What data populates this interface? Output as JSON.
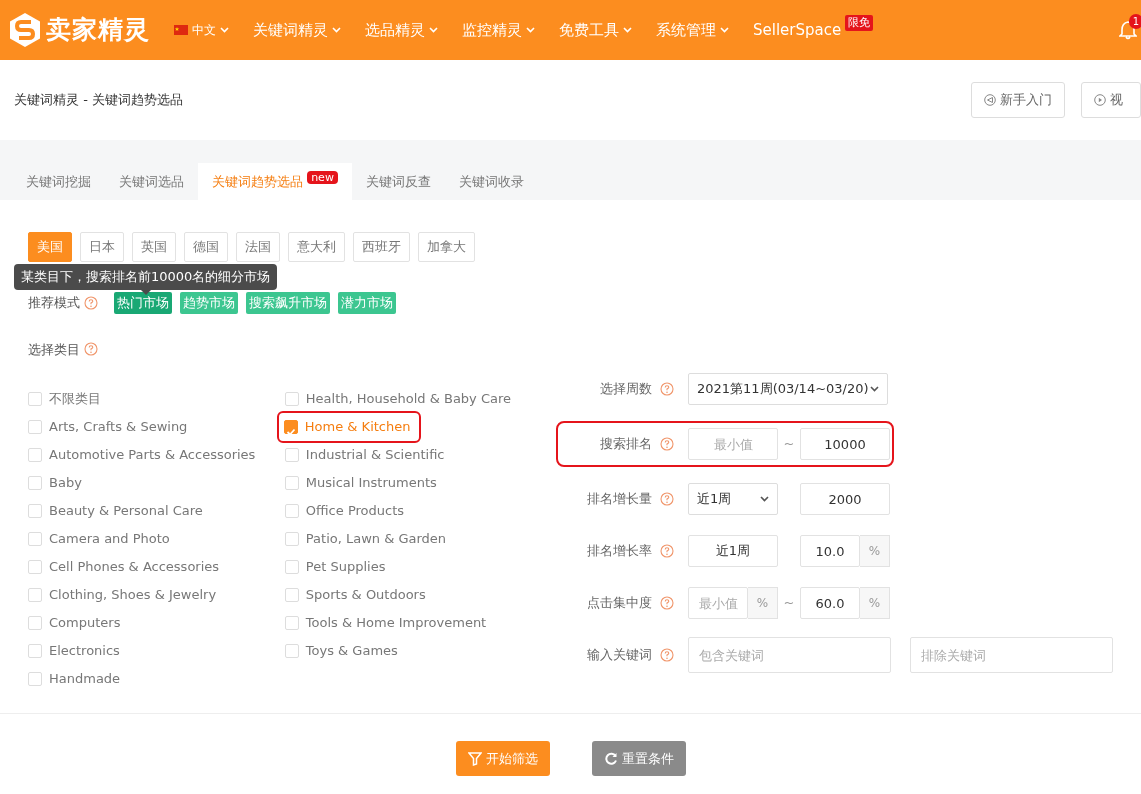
{
  "header": {
    "logo_text": "卖家精灵",
    "language": "中文",
    "nav": [
      {
        "label": "关键词精灵",
        "dropdown": true
      },
      {
        "label": "选品精灵",
        "dropdown": true
      },
      {
        "label": "监控精灵",
        "dropdown": true
      },
      {
        "label": "免费工具",
        "dropdown": true
      },
      {
        "label": "系统管理",
        "dropdown": true
      },
      {
        "label": "SellerSpace",
        "dropdown": false,
        "badge": "限免"
      }
    ],
    "notification_count": "1"
  },
  "breadcrumb": "关键词精灵 - 关键词趋势选品",
  "top_buttons": [
    {
      "label": "新手入门",
      "kind": "guide"
    },
    {
      "label": "视",
      "kind": "video"
    }
  ],
  "tabs": [
    {
      "label": "关键词挖掘",
      "selected": false
    },
    {
      "label": "关键词选品",
      "selected": false
    },
    {
      "label": "关键词趋势选品",
      "selected": true,
      "badge": "new"
    },
    {
      "label": "关键词反查",
      "selected": false
    },
    {
      "label": "关键词收录",
      "selected": false
    }
  ],
  "countries": [
    {
      "label": "美国",
      "selected": true
    },
    {
      "label": "日本",
      "selected": false
    },
    {
      "label": "英国",
      "selected": false
    },
    {
      "label": "德国",
      "selected": false
    },
    {
      "label": "法国",
      "selected": false
    },
    {
      "label": "意大利",
      "selected": false
    },
    {
      "label": "西班牙",
      "selected": false
    },
    {
      "label": "加拿大",
      "selected": false
    }
  ],
  "tooltip": "某类目下，搜索排名前10000名的细分市场",
  "mode": {
    "label": "推荐模式",
    "options": [
      {
        "label": "热门市场",
        "selected": true
      },
      {
        "label": "趋势市场",
        "selected": false
      },
      {
        "label": "搜索飙升市场",
        "selected": false
      },
      {
        "label": "潜力市场",
        "selected": false
      }
    ]
  },
  "category_label": "选择类目",
  "categories": [
    [
      {
        "label": "不限类目",
        "checked": false,
        "highlighted": false
      },
      {
        "label": "Arts, Crafts & Sewing",
        "checked": false,
        "highlighted": false
      },
      {
        "label": "Automotive Parts & Accessories",
        "checked": false,
        "highlighted": false
      },
      {
        "label": "Baby",
        "checked": false,
        "highlighted": false
      },
      {
        "label": "Beauty & Personal Care",
        "checked": false,
        "highlighted": false
      },
      {
        "label": "Camera and Photo",
        "checked": false,
        "highlighted": false
      },
      {
        "label": "Cell Phones & Accessories",
        "checked": false,
        "highlighted": false
      },
      {
        "label": "Clothing, Shoes & Jewelry",
        "checked": false,
        "highlighted": false
      },
      {
        "label": "Computers",
        "checked": false,
        "highlighted": false
      },
      {
        "label": "Electronics",
        "checked": false,
        "highlighted": false
      },
      {
        "label": "Handmade",
        "checked": false,
        "highlighted": false
      }
    ],
    [
      {
        "label": "Health, Household & Baby Care",
        "checked": false,
        "highlighted": false
      },
      {
        "label": "Home & Kitchen",
        "checked": true,
        "highlighted": true
      },
      {
        "label": "Industrial & Scientific",
        "checked": false,
        "highlighted": false
      },
      {
        "label": "Musical Instruments",
        "checked": false,
        "highlighted": false
      },
      {
        "label": "Office Products",
        "checked": false,
        "highlighted": false
      },
      {
        "label": "Patio, Lawn & Garden",
        "checked": false,
        "highlighted": false
      },
      {
        "label": "Pet Supplies",
        "checked": false,
        "highlighted": false
      },
      {
        "label": "Sports & Outdoors",
        "checked": false,
        "highlighted": false
      },
      {
        "label": "Tools & Home Improvement",
        "checked": false,
        "highlighted": false
      },
      {
        "label": "Toys & Games",
        "checked": false,
        "highlighted": false
      }
    ]
  ],
  "filters": [
    {
      "kind": "select",
      "label": "选择周数",
      "value": "2021第11周(03/14~03/20)",
      "highlighted": false
    },
    {
      "kind": "range",
      "label": "搜索排名",
      "min_placeholder": "最小值",
      "separator": "~",
      "max_value": "10000",
      "highlighted": true
    },
    {
      "kind": "period_select",
      "label": "排名增长量",
      "period": "近1周",
      "value": "2000",
      "highlighted": false
    },
    {
      "kind": "period_percent",
      "label": "排名增长率",
      "period": "近1周",
      "value": "10.0",
      "unit": "%",
      "highlighted": false
    },
    {
      "kind": "range_percent",
      "label": "点击集中度",
      "min_placeholder": "最小值",
      "min_unit": "%",
      "separator": "~",
      "max_value": "60.0",
      "unit": "%",
      "highlighted": false
    },
    {
      "kind": "keywords",
      "label": "输入关键词",
      "include_placeholder": "包含关键词",
      "exclude_placeholder": "排除关键词",
      "highlighted": false
    }
  ],
  "actions": [
    {
      "label": "开始筛选",
      "kind": "submit"
    },
    {
      "label": "重置条件",
      "kind": "reset"
    }
  ]
}
